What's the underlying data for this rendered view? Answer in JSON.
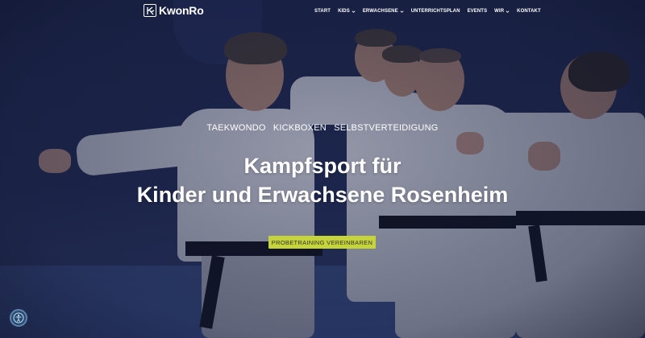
{
  "brand": {
    "name": "KwonRo"
  },
  "nav": {
    "items": [
      {
        "label": "START",
        "has_dropdown": false
      },
      {
        "label": "KIDS",
        "has_dropdown": true
      },
      {
        "label": "ERWACHSENE",
        "has_dropdown": true
      },
      {
        "label": "UNTERRICHTSPLAN",
        "has_dropdown": false
      },
      {
        "label": "EVENTS",
        "has_dropdown": false
      },
      {
        "label": "WIR",
        "has_dropdown": true
      },
      {
        "label": "KONTAKT",
        "has_dropdown": false
      }
    ]
  },
  "hero": {
    "tagline": [
      "TAEKWONDO",
      "KICKBOXEN",
      "SELBSTVERTEIDIGUNG"
    ],
    "headline_line1": "Kampfsport für",
    "headline_line2": "Kinder und Erwachsene Rosenheim",
    "cta_label": "PROBETRAINING VEREINBAREN"
  },
  "colors": {
    "cta_bg": "#c4d43a",
    "overlay": "#1c2444",
    "text": "#ffffff"
  },
  "icons": {
    "logo": "kwonro-logo-icon",
    "dropdown": "chevron-down-icon",
    "accessibility": "accessibility-icon"
  }
}
